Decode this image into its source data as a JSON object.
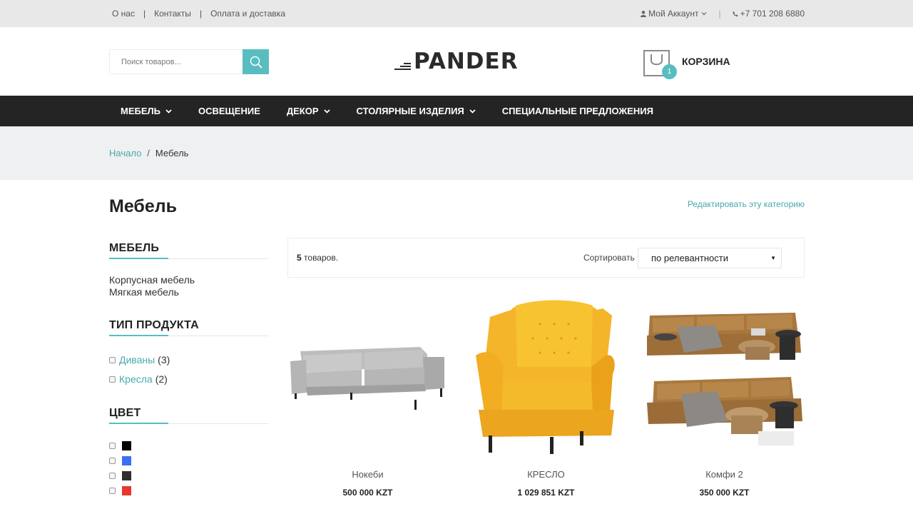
{
  "topbar": {
    "links": [
      "О нас",
      "Контакты",
      "Оплата и доставка"
    ],
    "account": "Мой Аккаунт",
    "phone": "+7 701 208 6880"
  },
  "search": {
    "placeholder": "Поиск товаров..."
  },
  "logo": {
    "text": "PANDER"
  },
  "cart": {
    "label": "КОРЗИНА",
    "count": "1"
  },
  "nav": {
    "items": [
      {
        "label": "МЕБЕЛЬ",
        "has_dropdown": true
      },
      {
        "label": "ОСВЕЩЕНИЕ",
        "has_dropdown": false
      },
      {
        "label": "ДЕКОР",
        "has_dropdown": true
      },
      {
        "label": "СТОЛЯРНЫЕ ИЗДЕЛИЯ",
        "has_dropdown": true
      },
      {
        "label": "СПЕЦИАЛЬНЫЕ ПРЕДЛОЖЕНИЯ",
        "has_dropdown": false
      }
    ]
  },
  "breadcrumb": {
    "home": "Начало",
    "separator": "/",
    "current": "Мебель"
  },
  "page": {
    "title": "Мебель",
    "edit_link": "Редактировать эту категорию"
  },
  "sidebar": {
    "category": {
      "heading": "МЕБЕЛЬ",
      "items": [
        "Корпусная мебель",
        "Мягкая мебель"
      ]
    },
    "product_type": {
      "heading": "ТИП ПРОДУКТА",
      "items": [
        {
          "label": "Диваны",
          "count": "(3)"
        },
        {
          "label": "Кресла",
          "count": "(2)"
        }
      ]
    },
    "color": {
      "heading": "ЦВЕТ",
      "swatches": [
        "#000000",
        "#3b6ff5",
        "#2f2f2f",
        "#e8382c"
      ]
    }
  },
  "toolbar": {
    "count_number": "5",
    "count_suffix": "товаров.",
    "sort_label": "Сортировать",
    "sort_value": "по релевантности"
  },
  "products": [
    {
      "name": "Нокеби",
      "price": "500 000 KZT",
      "image": "grey-sofa"
    },
    {
      "name": "КРЕСЛО",
      "price": "1 029 851 KZT",
      "image": "yellow-armchair"
    },
    {
      "name": "Комфи 2",
      "price": "350 000 KZT",
      "image": "brown-sofa-set"
    }
  ],
  "colors": {
    "accent": "#59bdc0",
    "link": "#48a9ad",
    "nav_bg": "#242424",
    "topbar_bg": "#e8e8e8",
    "crumbs_bg": "#eff0f2"
  }
}
